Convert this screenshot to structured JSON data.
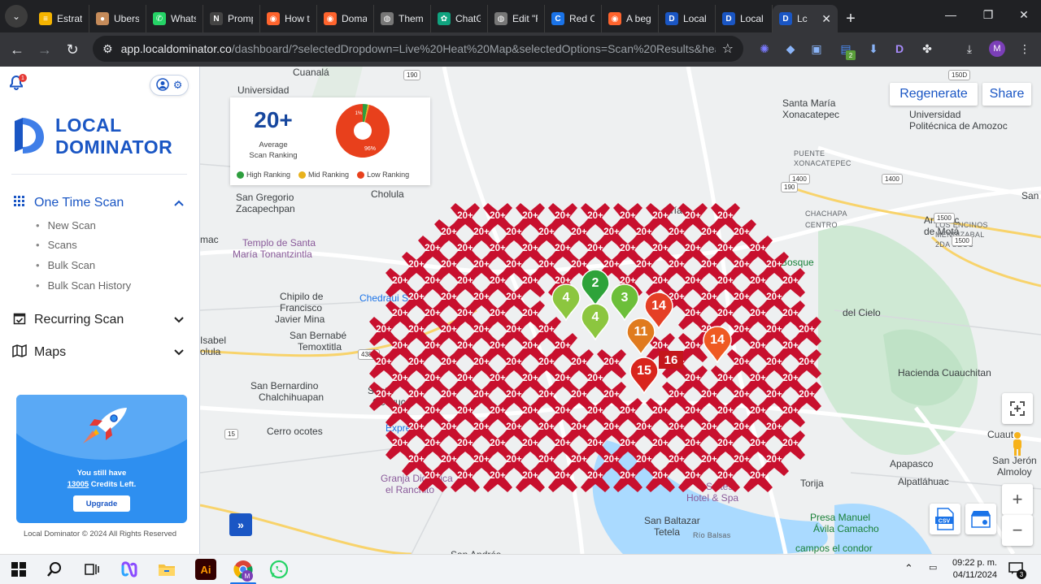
{
  "browser": {
    "tabs": [
      {
        "label": "Estrate",
        "icon": "docs-icon",
        "color": "#f5b400"
      },
      {
        "label": "Ubersu",
        "icon": "avatar-icon",
        "color": "#c58b5a"
      },
      {
        "label": "Whatsa",
        "icon": "whatsapp-icon",
        "color": "#25d366"
      },
      {
        "label": "Promp",
        "icon": "notion-icon",
        "color": "#444444"
      },
      {
        "label": "How t",
        "icon": "semrush-icon",
        "color": "#ff642d"
      },
      {
        "label": "Doma",
        "icon": "semrush-icon",
        "color": "#ff642d"
      },
      {
        "label": "Theme",
        "icon": "globe-icon",
        "color": "#777777"
      },
      {
        "label": "ChatG",
        "icon": "chatgpt-icon",
        "color": "#10a37f"
      },
      {
        "label": "Edit \"F",
        "icon": "globe-icon",
        "color": "#777777"
      },
      {
        "label": "Red C",
        "icon": "chrome-blue-icon",
        "color": "#1a73e8"
      },
      {
        "label": "A begi",
        "icon": "semrush-icon",
        "color": "#ff642d"
      },
      {
        "label": "Local",
        "icon": "localdominator-icon",
        "color": "#1a56c4"
      },
      {
        "label": "Local",
        "icon": "localdominator-icon",
        "color": "#1a56c4"
      }
    ],
    "active_tab": {
      "label": "Lc",
      "close": "✕"
    },
    "new_tab": "+",
    "url_host": "app.localdominator.co",
    "url_path": "/dashboard/?selectedDropdown=Live%20Heat%20Map&selectedOptions=Scan%20Results&heatma...",
    "profile_initial": "M",
    "extension_badge": "2"
  },
  "sidebar": {
    "notification_count": "1",
    "logo_line1": "LOCAL",
    "logo_line2": "DOMINATOR",
    "menu": [
      {
        "label": "One Time Scan",
        "icon": "grid-icon",
        "expanded": true,
        "items": [
          "New Scan",
          "Scans",
          "Bulk Scan",
          "Bulk Scan History"
        ]
      },
      {
        "label": "Recurring Scan",
        "icon": "calendar-check-icon",
        "expanded": false
      },
      {
        "label": "Maps",
        "icon": "map-icon",
        "expanded": false
      }
    ],
    "upgrade": {
      "line1": "You still have",
      "credits": "13005",
      "line2_suffix": " Credits Left.",
      "button": "Upgrade"
    },
    "footer": "Local Dominator © 2024 All Rights Reserved"
  },
  "stats": {
    "average_value": "20+",
    "average_label_line1": "Average",
    "average_label_line2": "Scan Ranking",
    "donut": {
      "low_percent": 96,
      "mid_percent": 1,
      "high_percent": 3,
      "label": "96%",
      "small_label": "1%"
    },
    "legend": [
      {
        "label": "High Ranking",
        "color": "#2e9e3e"
      },
      {
        "label": "Mid Ranking",
        "color": "#e8b21d"
      },
      {
        "label": "Low Ranking",
        "color": "#e8401c"
      }
    ]
  },
  "map": {
    "regenerate": "Regenerate",
    "share": "Share",
    "grid_label": "20+",
    "pins": [
      {
        "label": "2",
        "color": "#2ea33a"
      },
      {
        "label": "4",
        "color": "#8cc63f"
      },
      {
        "label": "3",
        "color": "#6cbf3a"
      },
      {
        "label": "4",
        "color": "#8cc63f"
      },
      {
        "label": "14",
        "color": "#e53f25"
      },
      {
        "label": "11",
        "color": "#e07b1e"
      },
      {
        "label": "14",
        "color": "#ef5a22"
      },
      {
        "label": "15",
        "color": "#d9251c"
      }
    ],
    "box_label": "16",
    "places": [
      {
        "text": "Cuanalá",
        "cls": ""
      },
      {
        "text": "Universidad",
        "cls": ""
      },
      {
        "text": "Santa María",
        "cls": ""
      },
      {
        "text": "Xonacatepec",
        "cls": ""
      },
      {
        "text": "Universidad",
        "cls": ""
      },
      {
        "text": "Politécnica de Amozoc",
        "cls": ""
      },
      {
        "text": "PUENTE",
        "cls": "small"
      },
      {
        "text": "XONACATEPEC",
        "cls": "small"
      },
      {
        "text": "San Gregorio",
        "cls": ""
      },
      {
        "text": "Zacapechpan",
        "cls": ""
      },
      {
        "text": "Cholula",
        "cls": ""
      },
      {
        "text": "CHACHAPA",
        "cls": "small"
      },
      {
        "text": "CENTRO",
        "cls": "small"
      },
      {
        "text": "Amozoc",
        "cls": ""
      },
      {
        "text": "de Motá",
        "cls": ""
      },
      {
        "text": "LOS ENCINOS",
        "cls": "small"
      },
      {
        "text": "MENDIZABAL",
        "cls": "small"
      },
      {
        "text": "2DA SECC",
        "cls": "small"
      },
      {
        "text": "Templo de Santa",
        "cls": "poi"
      },
      {
        "text": "María Tonantzintla",
        "cls": "poi"
      },
      {
        "text": "Chipilo de",
        "cls": ""
      },
      {
        "text": "Francisco",
        "cls": ""
      },
      {
        "text": "Javier Mina",
        "cls": ""
      },
      {
        "text": "Chedraui S",
        "cls": "blue"
      },
      {
        "text": "San Bernabé",
        "cls": ""
      },
      {
        "text": "Temoxtitla",
        "cls": ""
      },
      {
        "text": "Isabel",
        "cls": ""
      },
      {
        "text": "olula",
        "cls": ""
      },
      {
        "text": "Hacienda Cuauchitan",
        "cls": ""
      },
      {
        "text": "San Bernardino",
        "cls": ""
      },
      {
        "text": "Chalchihuapan",
        "cls": ""
      },
      {
        "text": "Santa",
        "cls": ""
      },
      {
        "text": "Ocoyuca",
        "cls": ""
      },
      {
        "text": "Cerro ocotes",
        "cls": ""
      },
      {
        "text": "Express",
        "cls": "blue"
      },
      {
        "text": "Granja Didactica",
        "cls": "poi"
      },
      {
        "text": "el Ranchito",
        "cls": "poi"
      },
      {
        "text": "Apapasco",
        "cls": ""
      },
      {
        "text": "Alpatláhuac",
        "cls": ""
      },
      {
        "text": "Cuaut",
        "cls": ""
      },
      {
        "text": "San Jerón",
        "cls": ""
      },
      {
        "text": "Almoloy",
        "cls": ""
      },
      {
        "text": "Torija",
        "cls": ""
      },
      {
        "text": "Presa Manuel",
        "cls": "green"
      },
      {
        "text": "Ávila Camacho",
        "cls": "green"
      },
      {
        "text": "campos el condor",
        "cls": "green"
      },
      {
        "text": "Suites",
        "cls": "poi"
      },
      {
        "text": "Hotel & Spa",
        "cls": "poi"
      },
      {
        "text": "San Baltazar",
        "cls": ""
      },
      {
        "text": "Tetela",
        "cls": ""
      },
      {
        "text": "San Andrés",
        "cls": ""
      },
      {
        "text": "Río Balsas",
        "cls": "small"
      },
      {
        "text": "del Cielo",
        "cls": ""
      },
      {
        "text": "Bosque",
        "cls": "green"
      },
      {
        "text": "San",
        "cls": ""
      },
      {
        "text": "aría",
        "cls": ""
      },
      {
        "text": "mac",
        "cls": ""
      }
    ],
    "route_shields": [
      "1400",
      "1400",
      "190",
      "150D",
      "1500",
      "1500",
      "438D",
      "190",
      "15"
    ],
    "csv_label": "CSV"
  },
  "taskbar": {
    "time": "09:22 p. m.",
    "date": "04/11/2024",
    "notif_count": "3"
  }
}
